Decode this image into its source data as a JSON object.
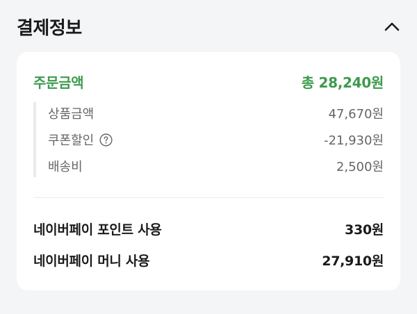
{
  "section": {
    "title": "결제정보",
    "toggle_icon": "chevron-up-icon"
  },
  "summary": {
    "total_label": "주문금액",
    "total_value": "총 28,240원",
    "accent_color": "#3d9a4c",
    "details": [
      {
        "label": "상품금액",
        "value": "47,670원"
      },
      {
        "label": "쿠폰할인",
        "value": "-21,930원",
        "help_icon": "question-circle-icon"
      },
      {
        "label": "배송비",
        "value": "2,500원"
      }
    ]
  },
  "payments": [
    {
      "label": "네이버페이 포인트 사용",
      "value": "330원"
    },
    {
      "label": "네이버페이 머니 사용",
      "value": "27,910원"
    }
  ]
}
